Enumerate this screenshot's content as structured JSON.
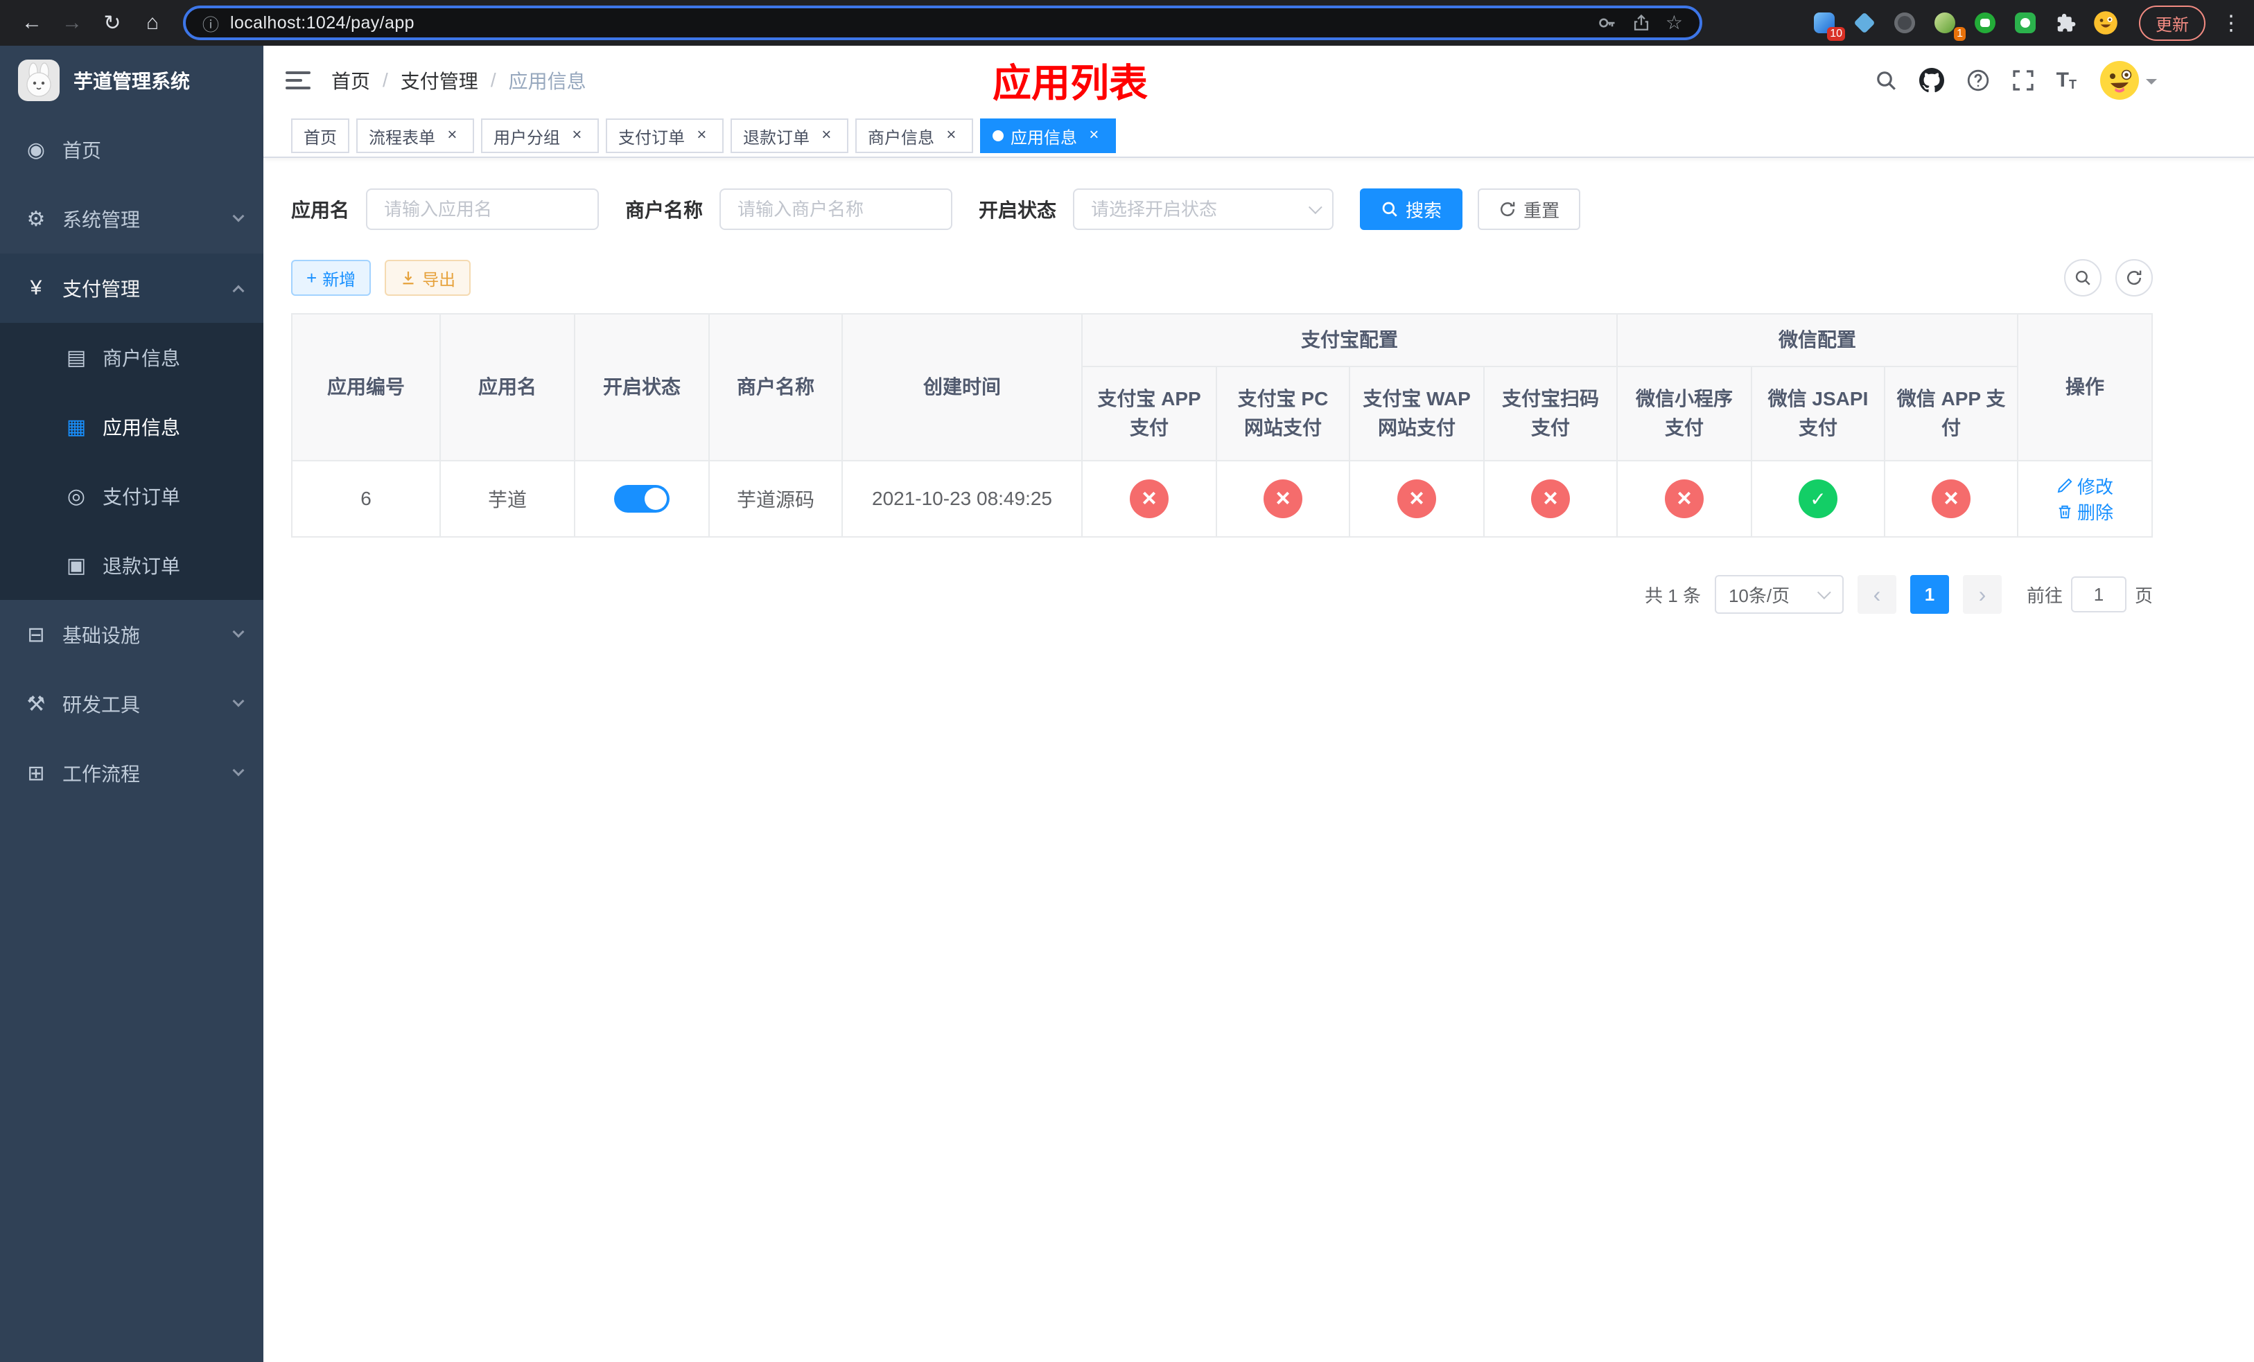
{
  "colors": {
    "primary": "#1890ff",
    "success": "#13ce66",
    "danger": "#f56c6c",
    "sidebar_bg": "#304156",
    "submenu_bg": "#1f2d3d",
    "title_red": "#ff0000"
  },
  "icons": {
    "back": "←",
    "forward": "→",
    "reload": "↻",
    "home": "⌂",
    "info": "ⓘ",
    "star": "☆",
    "kebab": "⋮",
    "dashboard": "◉",
    "gear": "⚙",
    "yen": "¥",
    "card": "▤",
    "grid": "▦",
    "order": "◎",
    "refund": "▣",
    "infra": "⊟",
    "tools": "⚒",
    "flow": "⊞",
    "plus": "+"
  },
  "browser": {
    "url": "localhost:1024/pay/app",
    "update_label": "更新",
    "ext_badge_1": "10",
    "ext_badge_2": "1"
  },
  "sidebar": {
    "title": "芋道管理系统",
    "menu": [
      {
        "label": "首页"
      },
      {
        "label": "系统管理"
      },
      {
        "label": "支付管理"
      },
      {
        "label": "基础设施"
      },
      {
        "label": "研发工具"
      },
      {
        "label": "工作流程"
      }
    ],
    "submenu": [
      {
        "label": "商户信息"
      },
      {
        "label": "应用信息"
      },
      {
        "label": "支付订单"
      },
      {
        "label": "退款订单"
      }
    ]
  },
  "header": {
    "breadcrumb": {
      "home": "首页",
      "section": "支付管理",
      "current": "应用信息",
      "separator": "/"
    },
    "page_title": "应用列表"
  },
  "tabs": [
    {
      "label": "首页"
    },
    {
      "label": "流程表单"
    },
    {
      "label": "用户分组"
    },
    {
      "label": "支付订单"
    },
    {
      "label": "退款订单"
    },
    {
      "label": "商户信息"
    },
    {
      "label": "应用信息"
    }
  ],
  "filters": {
    "app_name_label": "应用名",
    "app_name_placeholder": "请输入应用名",
    "merchant_label": "商户名称",
    "merchant_placeholder": "请输入商户名称",
    "status_label": "开启状态",
    "status_placeholder": "请选择开启状态",
    "search_label": "搜索",
    "reset_label": "重置"
  },
  "toolbar": {
    "add_label": "新增",
    "export_label": "导出"
  },
  "table": {
    "headers": {
      "app_id": "应用编号",
      "app_name": "应用名",
      "status": "开启状态",
      "merchant": "商户名称",
      "created": "创建时间",
      "alipay_group": "支付宝配置",
      "wechat_group": "微信配置",
      "actions": "操作",
      "alipay_app": "支付宝 APP 支付",
      "alipay_pc": "支付宝 PC 网站支付",
      "alipay_wap": "支付宝 WAP 网站支付",
      "alipay_scan": "支付宝扫码支付",
      "wx_mini": "微信小程序支付",
      "wx_jsapi": "微信 JSAPI 支付",
      "wx_app": "微信 APP 支付"
    },
    "row": {
      "app_id": "6",
      "app_name": "芋道",
      "status": "on",
      "merchant": "芋道源码",
      "created": "2021-10-23 08:49:25",
      "alipay_app": "disabled",
      "alipay_pc": "disabled",
      "alipay_wap": "disabled",
      "alipay_scan": "disabled",
      "wx_mini": "disabled",
      "wx_jsapi": "enabled",
      "wx_app": "disabled",
      "edit_label": "修改",
      "delete_label": "删除"
    }
  },
  "pagination": {
    "total": "共 1 条",
    "page_size": "10条/页",
    "current_page": "1",
    "goto_label": "前往",
    "goto_value": "1",
    "page_unit": "页"
  }
}
